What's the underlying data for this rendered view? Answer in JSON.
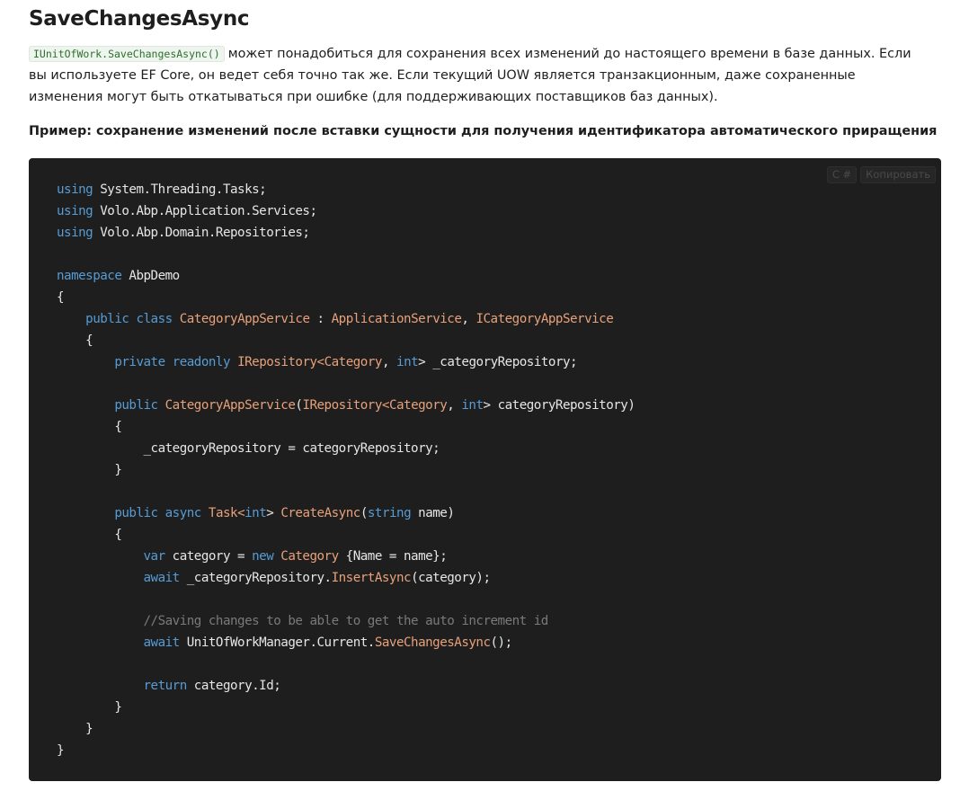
{
  "section": {
    "title": "SaveChangesAsync",
    "inline_code": "IUnitOfWork.SaveChangesAsync()",
    "paragraph_text": "может понадобиться для сохранения всех изменений до настоящего времени в базе данных. Если вы используете EF Core, он ведет себя точно так же. Если текущий UOW является транзакционным, даже сохраненные изменения могут быть откатываться при ошибке (для поддерживающих поставщиков баз данных).",
    "example_heading": "Пример: сохранение изменений после вставки сущности для получения идентификатора автоматического приращения"
  },
  "code_block": {
    "language_label": "C #",
    "copy_label": "Копировать",
    "lines": [
      [
        {
          "k": "kw",
          "t": "using"
        },
        {
          "k": "tx",
          "t": " System.Threading.Tasks;"
        }
      ],
      [
        {
          "k": "kw",
          "t": "using"
        },
        {
          "k": "tx",
          "t": " Volo.Abp.Application.Services;"
        }
      ],
      [
        {
          "k": "kw",
          "t": "using"
        },
        {
          "k": "tx",
          "t": " Volo.Abp.Domain.Repositories;"
        }
      ],
      [],
      [
        {
          "k": "kw",
          "t": "namespace"
        },
        {
          "k": "tx",
          "t": " AbpDemo"
        }
      ],
      [
        {
          "k": "tx",
          "t": "{"
        }
      ],
      [
        {
          "k": "tx",
          "t": "    "
        },
        {
          "k": "kw",
          "t": "public"
        },
        {
          "k": "tx",
          "t": " "
        },
        {
          "k": "kw",
          "t": "class"
        },
        {
          "k": "tx",
          "t": " "
        },
        {
          "k": "ty",
          "t": "CategoryAppService"
        },
        {
          "k": "tx",
          "t": " : "
        },
        {
          "k": "ty",
          "t": "ApplicationService"
        },
        {
          "k": "tx",
          "t": ", "
        },
        {
          "k": "ty",
          "t": "ICategoryAppService"
        }
      ],
      [
        {
          "k": "tx",
          "t": "    {"
        }
      ],
      [
        {
          "k": "tx",
          "t": "        "
        },
        {
          "k": "kw",
          "t": "private"
        },
        {
          "k": "tx",
          "t": " "
        },
        {
          "k": "kw",
          "t": "readonly"
        },
        {
          "k": "tx",
          "t": " "
        },
        {
          "k": "ty",
          "t": "IRepository"
        },
        {
          "k": "ch",
          "t": "<"
        },
        {
          "k": "ty",
          "t": "Category"
        },
        {
          "k": "tx",
          "t": ", "
        },
        {
          "k": "kw",
          "t": "int"
        },
        {
          "k": "tx",
          "t": "> _categoryRepository;"
        }
      ],
      [],
      [
        {
          "k": "tx",
          "t": "        "
        },
        {
          "k": "kw",
          "t": "public"
        },
        {
          "k": "tx",
          "t": " "
        },
        {
          "k": "ty",
          "t": "CategoryAppService"
        },
        {
          "k": "tx",
          "t": "("
        },
        {
          "k": "ty",
          "t": "IRepository"
        },
        {
          "k": "ch",
          "t": "<"
        },
        {
          "k": "ty",
          "t": "Category"
        },
        {
          "k": "tx",
          "t": ", "
        },
        {
          "k": "kw",
          "t": "int"
        },
        {
          "k": "tx",
          "t": "> categoryRepository)"
        }
      ],
      [
        {
          "k": "tx",
          "t": "        {"
        }
      ],
      [
        {
          "k": "tx",
          "t": "            _categoryRepository = categoryRepository;"
        }
      ],
      [
        {
          "k": "tx",
          "t": "        }"
        }
      ],
      [],
      [
        {
          "k": "tx",
          "t": "        "
        },
        {
          "k": "kw",
          "t": "public"
        },
        {
          "k": "tx",
          "t": " "
        },
        {
          "k": "kw",
          "t": "async"
        },
        {
          "k": "tx",
          "t": " "
        },
        {
          "k": "ty",
          "t": "Task"
        },
        {
          "k": "ch",
          "t": "<"
        },
        {
          "k": "kw",
          "t": "int"
        },
        {
          "k": "tx",
          "t": "> "
        },
        {
          "k": "ty",
          "t": "CreateAsync"
        },
        {
          "k": "tx",
          "t": "("
        },
        {
          "k": "kw",
          "t": "string"
        },
        {
          "k": "tx",
          "t": " name)"
        }
      ],
      [
        {
          "k": "tx",
          "t": "        {"
        }
      ],
      [
        {
          "k": "tx",
          "t": "            "
        },
        {
          "k": "kw",
          "t": "var"
        },
        {
          "k": "tx",
          "t": " category = "
        },
        {
          "k": "kw",
          "t": "new"
        },
        {
          "k": "tx",
          "t": " "
        },
        {
          "k": "ty",
          "t": "Category"
        },
        {
          "k": "tx",
          "t": " {Name = name};"
        }
      ],
      [
        {
          "k": "tx",
          "t": "            "
        },
        {
          "k": "kw",
          "t": "await"
        },
        {
          "k": "tx",
          "t": " _categoryRepository."
        },
        {
          "k": "ty",
          "t": "InsertAsync"
        },
        {
          "k": "tx",
          "t": "(category);"
        }
      ],
      [],
      [
        {
          "k": "tx",
          "t": "            "
        },
        {
          "k": "cm",
          "t": "//Saving changes to be able to get the auto increment id"
        }
      ],
      [
        {
          "k": "tx",
          "t": "            "
        },
        {
          "k": "kw",
          "t": "await"
        },
        {
          "k": "tx",
          "t": " UnitOfWorkManager.Current."
        },
        {
          "k": "ty",
          "t": "SaveChangesAsync"
        },
        {
          "k": "tx",
          "t": "();"
        }
      ],
      [],
      [
        {
          "k": "tx",
          "t": "            "
        },
        {
          "k": "kw",
          "t": "return"
        },
        {
          "k": "tx",
          "t": " category.Id;"
        }
      ],
      [
        {
          "k": "tx",
          "t": "        }"
        }
      ],
      [
        {
          "k": "tx",
          "t": "    }"
        }
      ],
      [
        {
          "k": "tx",
          "t": "}"
        }
      ]
    ]
  },
  "colors": {
    "keyword": "#569cd6",
    "type": "#e8a17a",
    "comment": "#7a7a7a",
    "code_background": "#1e1e1e",
    "inline_code_text": "#2f6f2f"
  }
}
